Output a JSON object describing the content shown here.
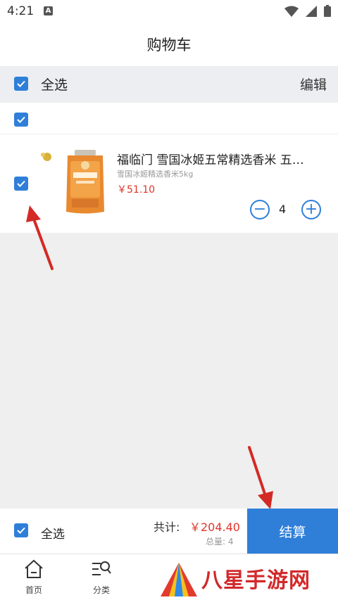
{
  "status_bar": {
    "time": "4:21",
    "notif_letter": "A"
  },
  "header": {
    "title": "购物车"
  },
  "select_all_row": {
    "label": "全选",
    "edit": "编辑"
  },
  "cart": {
    "items": [
      {
        "name": "福临门 雪国冰姬五常精选香米 五…",
        "spec": "雪国冰姬精选香米5kg",
        "price": "￥51.10",
        "quantity": "4",
        "minus": "−",
        "plus": "+"
      }
    ]
  },
  "checkout": {
    "select_all": "全选",
    "total_label": "共计:",
    "total_value": "￥204.40",
    "total_qty": "总量: 4",
    "button": "结算"
  },
  "tabs": [
    {
      "label": "首页",
      "icon": "home-icon"
    },
    {
      "label": "分类",
      "icon": "category-icon"
    }
  ],
  "watermark": {
    "text": "八星手游网"
  },
  "colors": {
    "accent": "#2f7fd9",
    "price": "#e0342b",
    "arrow": "#d42a25"
  }
}
